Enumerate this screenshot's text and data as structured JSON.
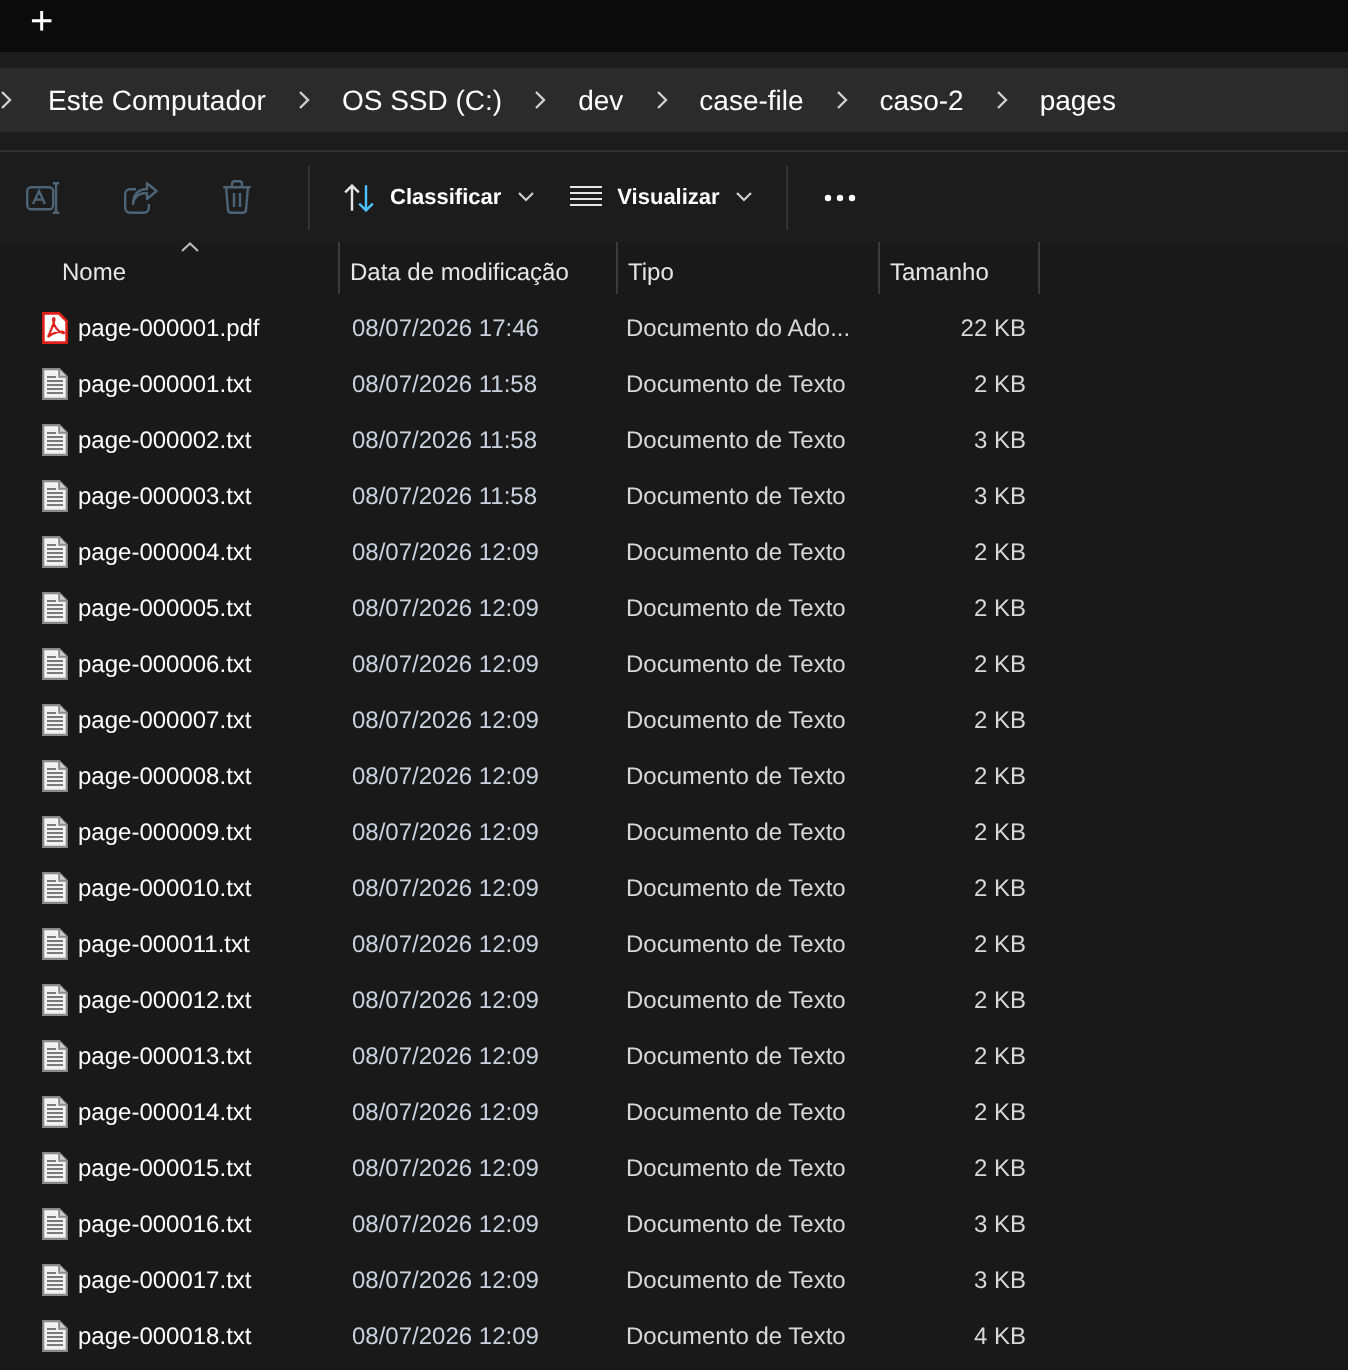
{
  "tab_bar": {
    "new_tab": "+"
  },
  "breadcrumb": [
    {
      "label": "Este Computador"
    },
    {
      "label": "OS SSD (C:)"
    },
    {
      "label": "dev"
    },
    {
      "label": "case-file"
    },
    {
      "label": "caso-2"
    },
    {
      "label": "pages"
    }
  ],
  "toolbar": {
    "actions": [
      {
        "kind": "rename",
        "disabled": true
      },
      {
        "kind": "share",
        "disabled": true
      },
      {
        "kind": "delete",
        "disabled": true
      }
    ],
    "sort_menu": {
      "label": "Classificar"
    },
    "view_menu": {
      "label": "Visualizar"
    }
  },
  "columns": [
    {
      "label": "Nome",
      "sorted": true
    },
    {
      "label": "Data de modificação",
      "sorted": false
    },
    {
      "label": "Tipo",
      "sorted": false
    },
    {
      "label": "Tamanho",
      "sorted": false
    }
  ],
  "files": [
    {
      "kind": "pdf",
      "name": "page-000001.pdf",
      "modified": "08/07/2026 17:46",
      "type": "Documento do Ado...",
      "size": "22 KB"
    },
    {
      "kind": "txt",
      "name": "page-000001.txt",
      "modified": "08/07/2026 11:58",
      "type": "Documento de Texto",
      "size": "2 KB"
    },
    {
      "kind": "txt",
      "name": "page-000002.txt",
      "modified": "08/07/2026 11:58",
      "type": "Documento de Texto",
      "size": "3 KB"
    },
    {
      "kind": "txt",
      "name": "page-000003.txt",
      "modified": "08/07/2026 11:58",
      "type": "Documento de Texto",
      "size": "3 KB"
    },
    {
      "kind": "txt",
      "name": "page-000004.txt",
      "modified": "08/07/2026 12:09",
      "type": "Documento de Texto",
      "size": "2 KB"
    },
    {
      "kind": "txt",
      "name": "page-000005.txt",
      "modified": "08/07/2026 12:09",
      "type": "Documento de Texto",
      "size": "2 KB"
    },
    {
      "kind": "txt",
      "name": "page-000006.txt",
      "modified": "08/07/2026 12:09",
      "type": "Documento de Texto",
      "size": "2 KB"
    },
    {
      "kind": "txt",
      "name": "page-000007.txt",
      "modified": "08/07/2026 12:09",
      "type": "Documento de Texto",
      "size": "2 KB"
    },
    {
      "kind": "txt",
      "name": "page-000008.txt",
      "modified": "08/07/2026 12:09",
      "type": "Documento de Texto",
      "size": "2 KB"
    },
    {
      "kind": "txt",
      "name": "page-000009.txt",
      "modified": "08/07/2026 12:09",
      "type": "Documento de Texto",
      "size": "2 KB"
    },
    {
      "kind": "txt",
      "name": "page-000010.txt",
      "modified": "08/07/2026 12:09",
      "type": "Documento de Texto",
      "size": "2 KB"
    },
    {
      "kind": "txt",
      "name": "page-000011.txt",
      "modified": "08/07/2026 12:09",
      "type": "Documento de Texto",
      "size": "2 KB"
    },
    {
      "kind": "txt",
      "name": "page-000012.txt",
      "modified": "08/07/2026 12:09",
      "type": "Documento de Texto",
      "size": "2 KB"
    },
    {
      "kind": "txt",
      "name": "page-000013.txt",
      "modified": "08/07/2026 12:09",
      "type": "Documento de Texto",
      "size": "2 KB"
    },
    {
      "kind": "txt",
      "name": "page-000014.txt",
      "modified": "08/07/2026 12:09",
      "type": "Documento de Texto",
      "size": "2 KB"
    },
    {
      "kind": "txt",
      "name": "page-000015.txt",
      "modified": "08/07/2026 12:09",
      "type": "Documento de Texto",
      "size": "2 KB"
    },
    {
      "kind": "txt",
      "name": "page-000016.txt",
      "modified": "08/07/2026 12:09",
      "type": "Documento de Texto",
      "size": "3 KB"
    },
    {
      "kind": "txt",
      "name": "page-000017.txt",
      "modified": "08/07/2026 12:09",
      "type": "Documento de Texto",
      "size": "3 KB"
    },
    {
      "kind": "txt",
      "name": "page-000018.txt",
      "modified": "08/07/2026 12:09",
      "type": "Documento de Texto",
      "size": "4 KB"
    }
  ]
}
